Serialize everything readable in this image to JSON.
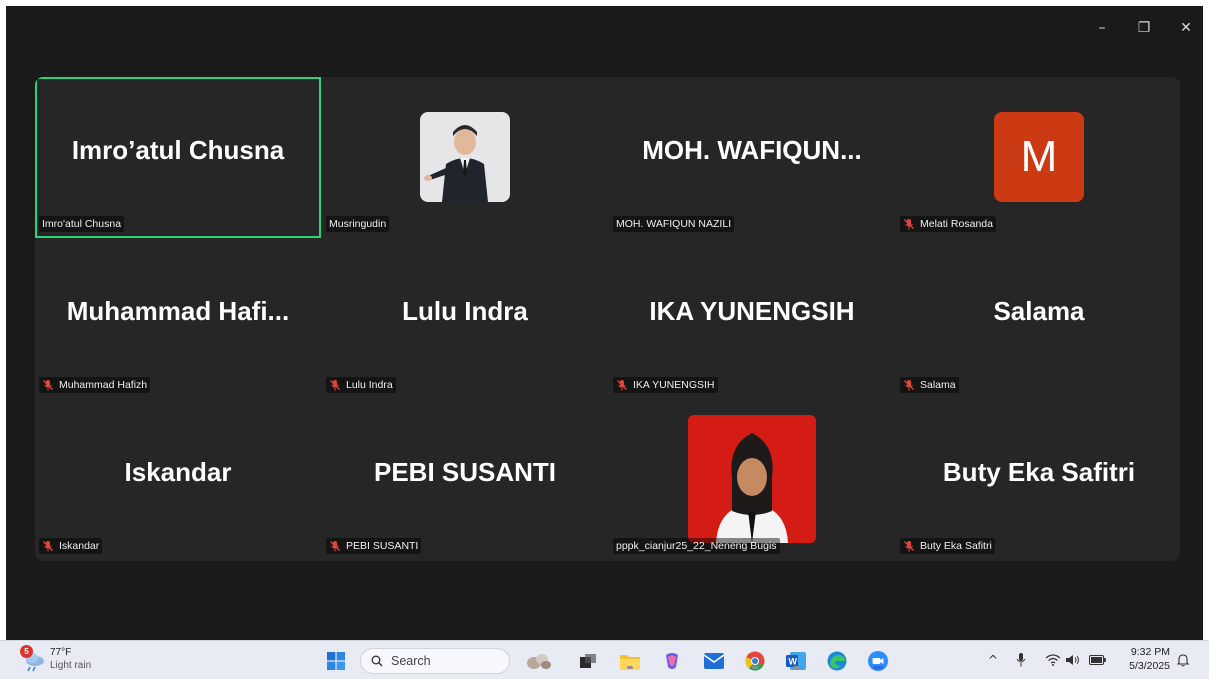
{
  "window_controls": {
    "minimize": "–",
    "restore": "❐",
    "close": "✕"
  },
  "participants": [
    {
      "display_name": "Imro’atul Chusna",
      "label": "Imro'atul Chusna",
      "muted": false,
      "active": true
    },
    {
      "display_name": "",
      "label": "Musringudin",
      "muted": false,
      "avatar": "photo-man-suit"
    },
    {
      "display_name": "MOH.  WAFIQUN...",
      "label": "MOH. WAFIQUN NAZILI",
      "muted": false
    },
    {
      "display_name": "",
      "label": "Melati Rosanda",
      "muted": true,
      "avatar_letter": "M"
    },
    {
      "display_name": "Muhammad  Hafi...",
      "label": "Muhammad Hafizh",
      "muted": true
    },
    {
      "display_name": "Lulu Indra",
      "label": "Lulu Indra",
      "muted": true
    },
    {
      "display_name": "IKA YUNENGSIH",
      "label": "IKA YUNENGSIH",
      "muted": true
    },
    {
      "display_name": "Salama",
      "label": "Salama",
      "muted": true
    },
    {
      "display_name": "Iskandar",
      "label": "Iskandar",
      "muted": true
    },
    {
      "display_name": "PEBI SUSANTI",
      "label": "PEBI SUSANTI",
      "muted": true
    },
    {
      "display_name": "",
      "label": "pppk_cianjur25_22_Neneng Bugis",
      "muted": false,
      "avatar": "photo-woman-hijab"
    },
    {
      "display_name": "Buty Eka Safitri",
      "label": "Buty Eka Safitri",
      "muted": true
    }
  ],
  "taskbar": {
    "weather": {
      "badge": "5",
      "temp": "77°F",
      "condition": "Light rain"
    },
    "search_placeholder": "Search",
    "clock": {
      "time": "9:32 PM",
      "date": "5/3/2025"
    },
    "tray": {
      "chevron": "^"
    },
    "colors": {
      "accent_active": "#2bd27a",
      "muted_mic": "#e0443a",
      "letter_avatar_bg": "#cc3a14"
    }
  }
}
